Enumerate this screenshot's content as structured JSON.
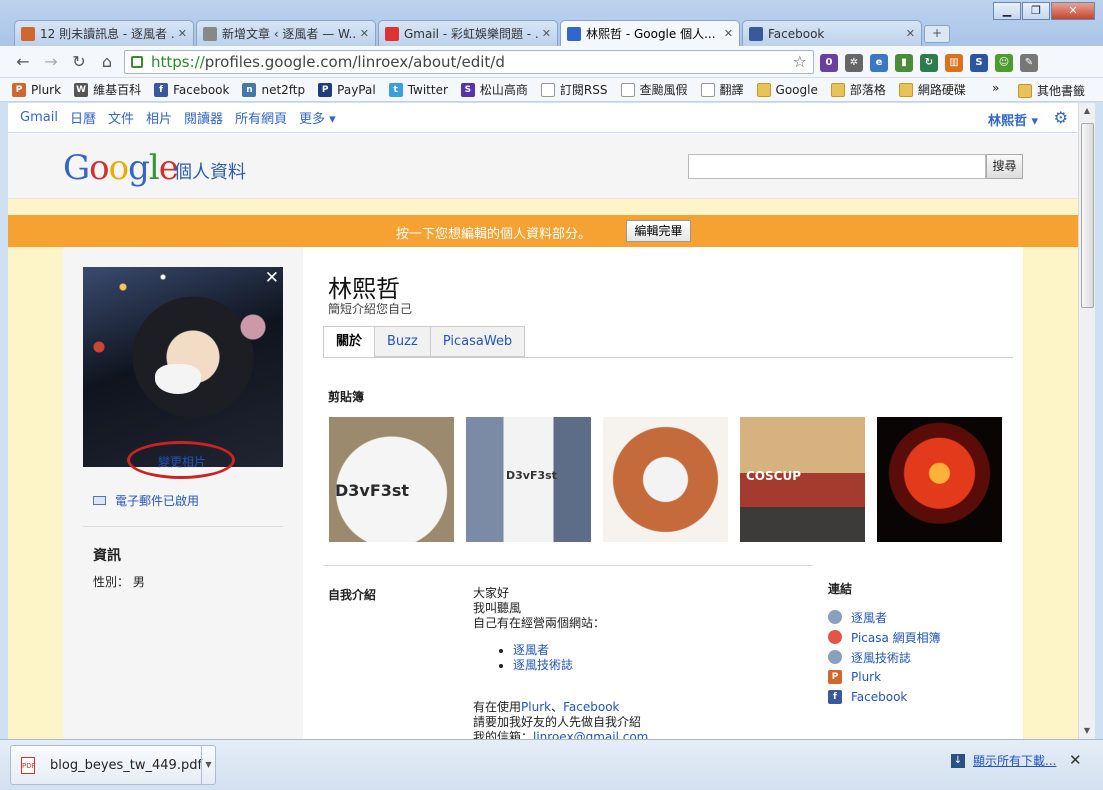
{
  "window": {
    "tabs": [
      {
        "label": "12 則未讀訊息 - 逐風者 ...",
        "icon": "plurk-icon",
        "color": "#cf682f"
      },
      {
        "label": "新增文章 ‹ 逐風者 — W...",
        "icon": "page-icon",
        "color": "#888888"
      },
      {
        "label": "Gmail - 彩虹娛樂問題 - ...",
        "icon": "gmail-icon",
        "color": "#d33"
      },
      {
        "label": "林熙哲 - Google 個人...",
        "icon": "google-icon",
        "color": "#3366cc"
      },
      {
        "label": "Facebook",
        "icon": "facebook-icon",
        "color": "#3b5998"
      }
    ],
    "active_tab": 3
  },
  "toolbar": {
    "url_scheme": "https://",
    "url_rest": "profiles.google.com/linroex/about/edit/d"
  },
  "bookmarks": {
    "items": [
      {
        "label": "Plurk",
        "icon": "plurk-icon",
        "color": "#cf682f",
        "mark": "P"
      },
      {
        "label": "維基百科",
        "icon": "wikipedia-icon",
        "color": "#555555",
        "mark": "W"
      },
      {
        "label": "Facebook",
        "icon": "facebook-icon",
        "color": "#3b5998",
        "mark": "f"
      },
      {
        "label": "net2ftp",
        "icon": "net2ftp-icon",
        "color": "#4477aa",
        "mark": "n"
      },
      {
        "label": "PayPal",
        "icon": "paypal-icon",
        "color": "#1f3d7a",
        "mark": "P"
      },
      {
        "label": "Twitter",
        "icon": "twitter-icon",
        "color": "#3aa0dd",
        "mark": "t"
      },
      {
        "label": "松山高商",
        "icon": "school-icon",
        "color": "#5533aa",
        "mark": "S"
      },
      {
        "label": "訂閱RSS",
        "icon": "page-icon",
        "color": "",
        "mark": ""
      },
      {
        "label": "查颱風假",
        "icon": "page-icon",
        "color": "",
        "mark": ""
      },
      {
        "label": "翻譯",
        "icon": "page-icon",
        "color": "",
        "mark": ""
      },
      {
        "label": "Google",
        "icon": "folder-icon",
        "color": "",
        "mark": ""
      },
      {
        "label": "部落格",
        "icon": "folder-icon",
        "color": "",
        "mark": ""
      },
      {
        "label": "網路硬碟",
        "icon": "folder-icon",
        "color": "",
        "mark": ""
      }
    ],
    "more": "»",
    "other": "其他書籤"
  },
  "gbar": {
    "links": [
      "Gmail",
      "日曆",
      "文件",
      "相片",
      "閱讀器",
      "所有網頁",
      "更多 ▾"
    ],
    "user": "林熙哲 ▾"
  },
  "header": {
    "product": "個人資料",
    "search_button": "搜尋"
  },
  "editbar": {
    "message": "按一下您想編輯的個人資料部分。",
    "done_button": "編輯完畢"
  },
  "sidebar": {
    "change_photo": "變更相片",
    "email_status": "電子郵件已啟用",
    "info_heading": "資訊",
    "gender": "性別： 男"
  },
  "profile": {
    "name": "林熙哲",
    "intro": "簡短介紹您自己",
    "tabs": [
      "關於",
      "Buzz",
      "PicasaWeb"
    ],
    "clipboard_heading": "剪貼簿",
    "thumb_texts": [
      "D3vF3st",
      "D3vF3st",
      "",
      "COSCUP",
      ""
    ],
    "self_heading": "自我介紹",
    "self_lines": [
      "大家好",
      "我叫聽風",
      "自己有在經營兩個網站："
    ],
    "self_list": [
      "逐風者",
      "逐風技術誌"
    ],
    "using_prefix": "有在使用",
    "using_plurk": "Plurk",
    "using_sep": "、",
    "using_facebook": "Facebook",
    "add_friend": "請要加我好友的人先做自我介紹",
    "mail_prefix": "我的信箱：",
    "mail": "linroex@gmail.com",
    "links_heading": "連結",
    "links": [
      {
        "label": "逐風者",
        "icon": "blog-icon",
        "color": "#8aa0c0",
        "mark": ""
      },
      {
        "label": "Picasa 網頁相簿",
        "icon": "picasa-icon",
        "color": "#e0574a",
        "mark": ""
      },
      {
        "label": "逐風技術誌",
        "icon": "blog-icon",
        "color": "#8aa0c0",
        "mark": ""
      },
      {
        "label": "Plurk",
        "icon": "plurk-icon",
        "color": "#cf682f",
        "mark": "P"
      },
      {
        "label": "Facebook",
        "icon": "facebook-icon",
        "color": "#3b5998",
        "mark": "f"
      }
    ]
  },
  "downloads": {
    "file": "blog_beyes_tw_449.pdf",
    "show_all": "顯示所有下載..."
  }
}
